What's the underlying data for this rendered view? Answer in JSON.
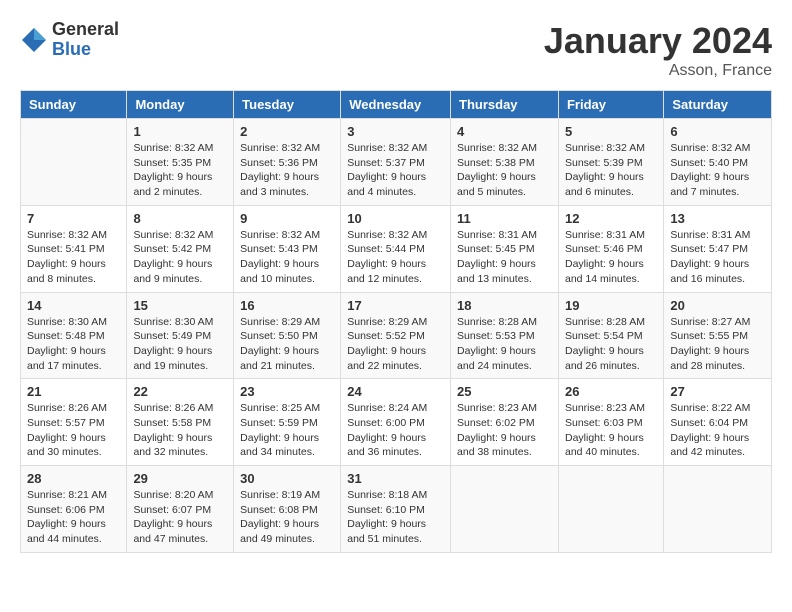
{
  "logo": {
    "general": "General",
    "blue": "Blue"
  },
  "title": "January 2024",
  "location": "Asson, France",
  "weekdays": [
    "Sunday",
    "Monday",
    "Tuesday",
    "Wednesday",
    "Thursday",
    "Friday",
    "Saturday"
  ],
  "weeks": [
    [
      {
        "day": "",
        "sunrise": "",
        "sunset": "",
        "daylight": ""
      },
      {
        "day": "1",
        "sunrise": "Sunrise: 8:32 AM",
        "sunset": "Sunset: 5:35 PM",
        "daylight": "Daylight: 9 hours and 2 minutes."
      },
      {
        "day": "2",
        "sunrise": "Sunrise: 8:32 AM",
        "sunset": "Sunset: 5:36 PM",
        "daylight": "Daylight: 9 hours and 3 minutes."
      },
      {
        "day": "3",
        "sunrise": "Sunrise: 8:32 AM",
        "sunset": "Sunset: 5:37 PM",
        "daylight": "Daylight: 9 hours and 4 minutes."
      },
      {
        "day": "4",
        "sunrise": "Sunrise: 8:32 AM",
        "sunset": "Sunset: 5:38 PM",
        "daylight": "Daylight: 9 hours and 5 minutes."
      },
      {
        "day": "5",
        "sunrise": "Sunrise: 8:32 AM",
        "sunset": "Sunset: 5:39 PM",
        "daylight": "Daylight: 9 hours and 6 minutes."
      },
      {
        "day": "6",
        "sunrise": "Sunrise: 8:32 AM",
        "sunset": "Sunset: 5:40 PM",
        "daylight": "Daylight: 9 hours and 7 minutes."
      }
    ],
    [
      {
        "day": "7",
        "sunrise": "Sunrise: 8:32 AM",
        "sunset": "Sunset: 5:41 PM",
        "daylight": "Daylight: 9 hours and 8 minutes."
      },
      {
        "day": "8",
        "sunrise": "Sunrise: 8:32 AM",
        "sunset": "Sunset: 5:42 PM",
        "daylight": "Daylight: 9 hours and 9 minutes."
      },
      {
        "day": "9",
        "sunrise": "Sunrise: 8:32 AM",
        "sunset": "Sunset: 5:43 PM",
        "daylight": "Daylight: 9 hours and 10 minutes."
      },
      {
        "day": "10",
        "sunrise": "Sunrise: 8:32 AM",
        "sunset": "Sunset: 5:44 PM",
        "daylight": "Daylight: 9 hours and 12 minutes."
      },
      {
        "day": "11",
        "sunrise": "Sunrise: 8:31 AM",
        "sunset": "Sunset: 5:45 PM",
        "daylight": "Daylight: 9 hours and 13 minutes."
      },
      {
        "day": "12",
        "sunrise": "Sunrise: 8:31 AM",
        "sunset": "Sunset: 5:46 PM",
        "daylight": "Daylight: 9 hours and 14 minutes."
      },
      {
        "day": "13",
        "sunrise": "Sunrise: 8:31 AM",
        "sunset": "Sunset: 5:47 PM",
        "daylight": "Daylight: 9 hours and 16 minutes."
      }
    ],
    [
      {
        "day": "14",
        "sunrise": "Sunrise: 8:30 AM",
        "sunset": "Sunset: 5:48 PM",
        "daylight": "Daylight: 9 hours and 17 minutes."
      },
      {
        "day": "15",
        "sunrise": "Sunrise: 8:30 AM",
        "sunset": "Sunset: 5:49 PM",
        "daylight": "Daylight: 9 hours and 19 minutes."
      },
      {
        "day": "16",
        "sunrise": "Sunrise: 8:29 AM",
        "sunset": "Sunset: 5:50 PM",
        "daylight": "Daylight: 9 hours and 21 minutes."
      },
      {
        "day": "17",
        "sunrise": "Sunrise: 8:29 AM",
        "sunset": "Sunset: 5:52 PM",
        "daylight": "Daylight: 9 hours and 22 minutes."
      },
      {
        "day": "18",
        "sunrise": "Sunrise: 8:28 AM",
        "sunset": "Sunset: 5:53 PM",
        "daylight": "Daylight: 9 hours and 24 minutes."
      },
      {
        "day": "19",
        "sunrise": "Sunrise: 8:28 AM",
        "sunset": "Sunset: 5:54 PM",
        "daylight": "Daylight: 9 hours and 26 minutes."
      },
      {
        "day": "20",
        "sunrise": "Sunrise: 8:27 AM",
        "sunset": "Sunset: 5:55 PM",
        "daylight": "Daylight: 9 hours and 28 minutes."
      }
    ],
    [
      {
        "day": "21",
        "sunrise": "Sunrise: 8:26 AM",
        "sunset": "Sunset: 5:57 PM",
        "daylight": "Daylight: 9 hours and 30 minutes."
      },
      {
        "day": "22",
        "sunrise": "Sunrise: 8:26 AM",
        "sunset": "Sunset: 5:58 PM",
        "daylight": "Daylight: 9 hours and 32 minutes."
      },
      {
        "day": "23",
        "sunrise": "Sunrise: 8:25 AM",
        "sunset": "Sunset: 5:59 PM",
        "daylight": "Daylight: 9 hours and 34 minutes."
      },
      {
        "day": "24",
        "sunrise": "Sunrise: 8:24 AM",
        "sunset": "Sunset: 6:00 PM",
        "daylight": "Daylight: 9 hours and 36 minutes."
      },
      {
        "day": "25",
        "sunrise": "Sunrise: 8:23 AM",
        "sunset": "Sunset: 6:02 PM",
        "daylight": "Daylight: 9 hours and 38 minutes."
      },
      {
        "day": "26",
        "sunrise": "Sunrise: 8:23 AM",
        "sunset": "Sunset: 6:03 PM",
        "daylight": "Daylight: 9 hours and 40 minutes."
      },
      {
        "day": "27",
        "sunrise": "Sunrise: 8:22 AM",
        "sunset": "Sunset: 6:04 PM",
        "daylight": "Daylight: 9 hours and 42 minutes."
      }
    ],
    [
      {
        "day": "28",
        "sunrise": "Sunrise: 8:21 AM",
        "sunset": "Sunset: 6:06 PM",
        "daylight": "Daylight: 9 hours and 44 minutes."
      },
      {
        "day": "29",
        "sunrise": "Sunrise: 8:20 AM",
        "sunset": "Sunset: 6:07 PM",
        "daylight": "Daylight: 9 hours and 47 minutes."
      },
      {
        "day": "30",
        "sunrise": "Sunrise: 8:19 AM",
        "sunset": "Sunset: 6:08 PM",
        "daylight": "Daylight: 9 hours and 49 minutes."
      },
      {
        "day": "31",
        "sunrise": "Sunrise: 8:18 AM",
        "sunset": "Sunset: 6:10 PM",
        "daylight": "Daylight: 9 hours and 51 minutes."
      },
      {
        "day": "",
        "sunrise": "",
        "sunset": "",
        "daylight": ""
      },
      {
        "day": "",
        "sunrise": "",
        "sunset": "",
        "daylight": ""
      },
      {
        "day": "",
        "sunrise": "",
        "sunset": "",
        "daylight": ""
      }
    ]
  ]
}
